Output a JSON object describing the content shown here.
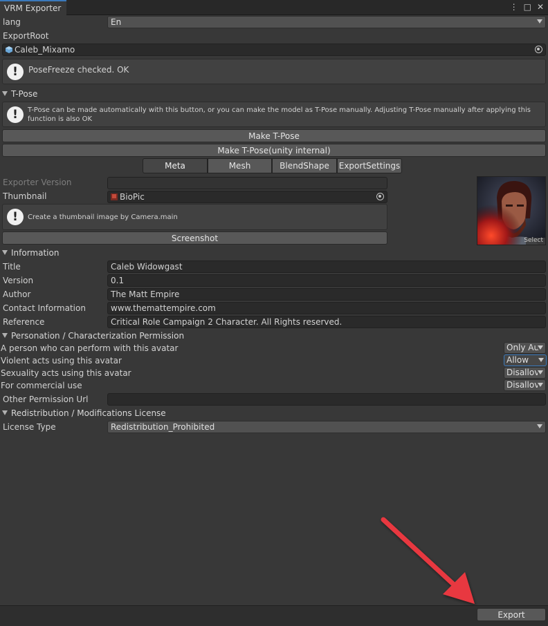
{
  "window": {
    "tab_title": "VRM Exporter",
    "menu_icon": "⋮",
    "maximize_icon": "□",
    "close_icon": "✕"
  },
  "lang": {
    "label": "lang",
    "value": "En"
  },
  "export_root": {
    "label": "ExportRoot",
    "value": "Caleb_Mixamo"
  },
  "pose_freeze_msg": "PoseFreeze checked. OK",
  "tpose": {
    "header": "T-Pose",
    "help": "T-Pose can be made automatically with this button, or you can make the model as T-Pose manually. Adjusting T-Pose manually after applying this function is also OK",
    "make_button": "Make T-Pose",
    "make_internal_button": "Make T-Pose(unity internal)"
  },
  "tabs": [
    "Meta",
    "Mesh",
    "BlendShape",
    "ExportSettings"
  ],
  "meta": {
    "exporter_version_label": "Exporter Version",
    "exporter_version_value": "",
    "thumbnail_label": "Thumbnail",
    "thumbnail_value": "BioPic",
    "thumbnail_help": "Create a thumbnail image by Camera.main",
    "screenshot_button": "Screenshot",
    "select_label": "Select"
  },
  "information": {
    "header": "Information",
    "fields": [
      {
        "label": "Title",
        "value": "Caleb Widowgast"
      },
      {
        "label": "Version",
        "value": "0.1"
      },
      {
        "label": "Author",
        "value": "The Matt Empire"
      },
      {
        "label": "Contact Information",
        "value": "www.themattempire.com"
      },
      {
        "label": "Reference",
        "value": "Critical Role Campaign 2 Character. All Rights reserved."
      }
    ]
  },
  "permission": {
    "header": "Personation / Characterization Permission",
    "rows": [
      {
        "label": "A person who can perform with this avatar",
        "value": "Only Au"
      },
      {
        "label": "Violent acts using this avatar",
        "value": "Allow"
      },
      {
        "label": "Sexuality acts using this avatar",
        "value": "Disallov"
      },
      {
        "label": "For commercial use",
        "value": "Disallov"
      }
    ],
    "other_url_label": "Other Permission Url",
    "other_url_value": ""
  },
  "license": {
    "header": "Redistribution / Modifications License",
    "type_label": "License Type",
    "type_value": "Redistribution_Prohibited"
  },
  "export_button": "Export",
  "colors": {
    "background": "#383838",
    "accent": "#3a79bb",
    "arrow": "#e8393f"
  }
}
